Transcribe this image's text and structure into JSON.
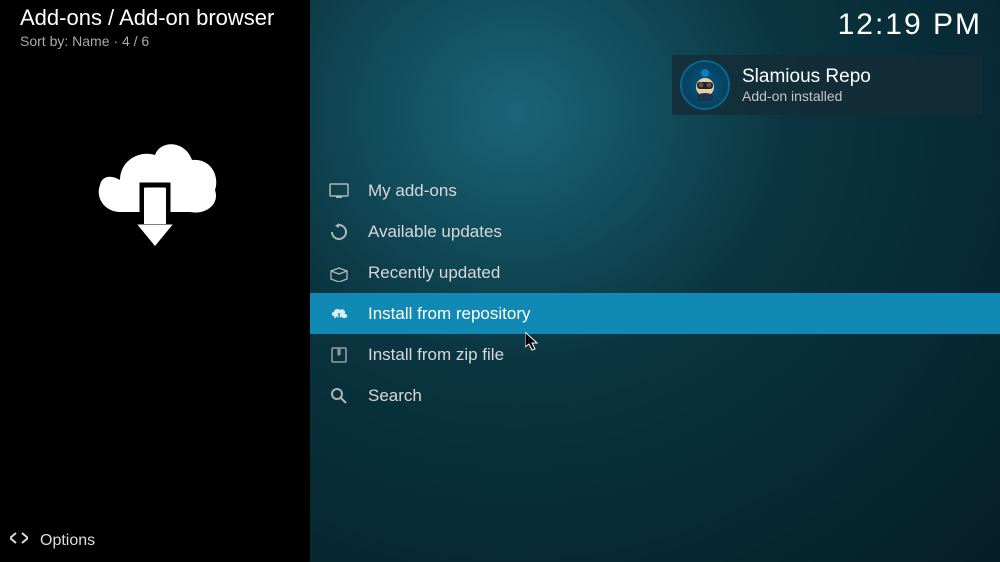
{
  "header": {
    "breadcrumb": "Add-ons / Add-on browser",
    "sort_label": "Sort by: Name",
    "position": "4 / 6"
  },
  "clock": "12:19 PM",
  "menu": {
    "items": [
      {
        "label": "My add-ons",
        "icon": "screen-icon",
        "selected": false
      },
      {
        "label": "Available updates",
        "icon": "refresh-icon",
        "selected": false
      },
      {
        "label": "Recently updated",
        "icon": "box-open-icon",
        "selected": false
      },
      {
        "label": "Install from repository",
        "icon": "cloud-download-icon",
        "selected": true
      },
      {
        "label": "Install from zip file",
        "icon": "zip-icon",
        "selected": false
      },
      {
        "label": "Search",
        "icon": "search-icon",
        "selected": false
      }
    ]
  },
  "notification": {
    "title": "Slamious Repo",
    "subtitle": "Add-on installed"
  },
  "footer": {
    "options": "Options"
  }
}
